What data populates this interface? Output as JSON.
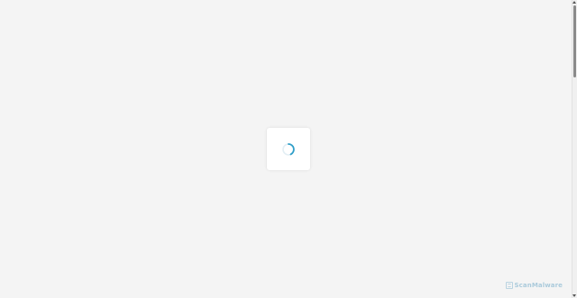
{
  "loader": {
    "icon": "spinner-icon",
    "accent_color": "#2f9ec8",
    "track_color": "#e3eef4"
  },
  "branding": {
    "icon": "scanmalware-logo-icon",
    "name": "ScanMalware",
    "color": "#6fa9c8"
  },
  "scrollbar": {
    "up_icon": "scroll-up-arrow-icon",
    "down_icon": "scroll-down-arrow-icon"
  }
}
